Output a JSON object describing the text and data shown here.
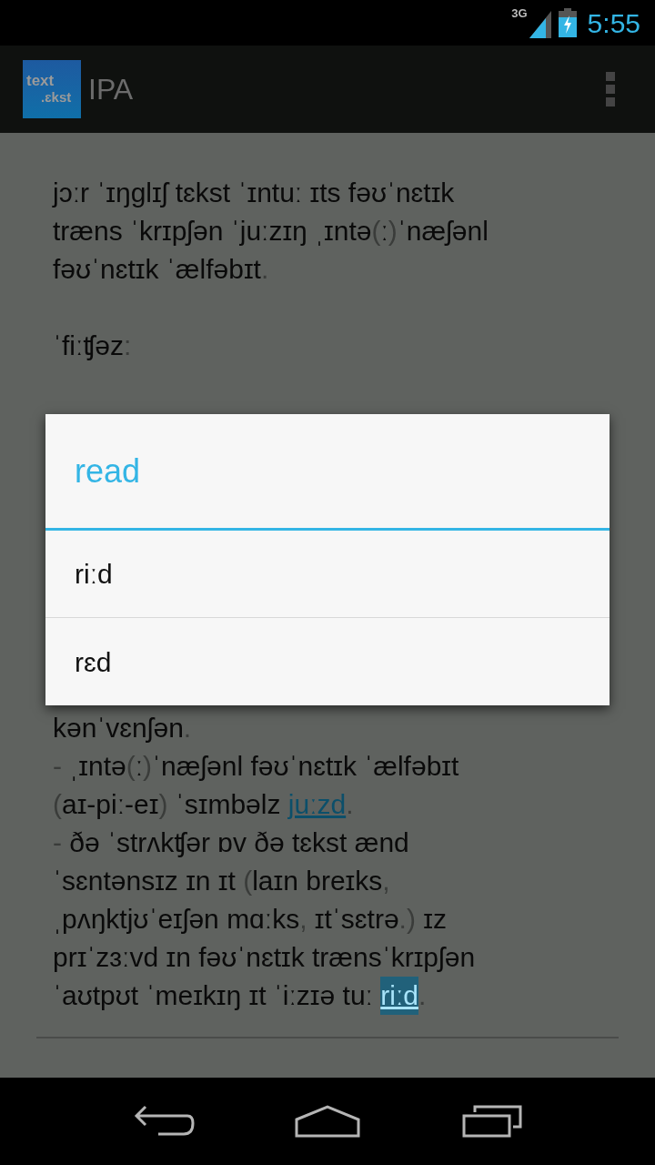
{
  "status_bar": {
    "network": "3G",
    "time": "5:55"
  },
  "action_bar": {
    "logo": {
      "top": "text",
      "bottom": ".ɛkst"
    },
    "title": "IPA"
  },
  "content_top": [
    [
      [
        {
          "kind": "text",
          "text": "jɔːr ˈɪŋglɪʃ tɛkst ˈɪntuː ɪts fəʊˈnɛtɪk"
        }
      ],
      [
        {
          "kind": "text",
          "text": "træns ˈkrɪpʃən ˈjuːzɪŋ ˌɪntə"
        },
        {
          "kind": "punct",
          "text": "("
        },
        {
          "kind": "text",
          "text": "ː"
        },
        {
          "kind": "punct",
          "text": ")"
        },
        {
          "kind": "text",
          "text": "ˈnæʃənl"
        }
      ],
      [
        {
          "kind": "text",
          "text": "fəʊˈnɛtɪk ˈælfəbɪt"
        },
        {
          "kind": "punct",
          "text": "."
        }
      ]
    ],
    [
      [
        {
          "kind": "text",
          "text": "ˈfiːʧəz"
        },
        {
          "kind": "punct",
          "text": ":"
        }
      ]
    ]
  ],
  "content_bottom": [
    [
      {
        "kind": "text",
        "text": "kənˈvɛnʃən"
      },
      {
        "kind": "punct",
        "text": "."
      }
    ],
    [
      {
        "kind": "punct",
        "text": "- "
      },
      {
        "kind": "text",
        "text": "ˌɪntə"
      },
      {
        "kind": "punct",
        "text": "("
      },
      {
        "kind": "text",
        "text": "ː"
      },
      {
        "kind": "punct",
        "text": ")"
      },
      {
        "kind": "text",
        "text": "ˈnæʃənl fəʊˈnɛtɪk ˈælfəbɪt"
      }
    ],
    [
      {
        "kind": "punct",
        "text": "("
      },
      {
        "kind": "text",
        "text": "aɪ-piː-eɪ"
      },
      {
        "kind": "punct",
        "text": ")"
      },
      {
        "kind": "text",
        "text": " ˈsɪmbəlz "
      },
      {
        "kind": "link",
        "text": "juːzd",
        "selected": false
      },
      {
        "kind": "punct",
        "text": "."
      }
    ],
    [
      {
        "kind": "punct",
        "text": "- "
      },
      {
        "kind": "text",
        "text": "ðə ˈstrʌkʧər ɒv ðə tɛkst ænd"
      }
    ],
    [
      {
        "kind": "text",
        "text": "ˈsɛntənsɪz ɪn ɪt "
      },
      {
        "kind": "punct",
        "text": "("
      },
      {
        "kind": "text",
        "text": "laɪn breɪks"
      },
      {
        "kind": "punct",
        "text": ","
      }
    ],
    [
      {
        "kind": "text",
        "text": "ˌpʌŋktjʊˈeɪʃən mɑːks"
      },
      {
        "kind": "punct",
        "text": ","
      },
      {
        "kind": "text",
        "text": " ɪtˈsɛtrə"
      },
      {
        "kind": "punct",
        "text": ".)"
      },
      {
        "kind": "text",
        "text": " ɪz"
      }
    ],
    [
      {
        "kind": "text",
        "text": "prɪˈzɜːvd ɪn fəʊˈnɛtɪk trænsˈkrɪpʃən"
      }
    ],
    [
      {
        "kind": "text",
        "text": "ˈaʊtpʊt ˈmeɪkɪŋ ɪt ˈiːzɪə tuː "
      },
      {
        "kind": "link",
        "text": "riːd",
        "selected": true
      },
      {
        "kind": "punct",
        "text": "."
      }
    ]
  ],
  "dialog": {
    "title": "read",
    "options": [
      "riːd",
      "rɛd"
    ]
  }
}
